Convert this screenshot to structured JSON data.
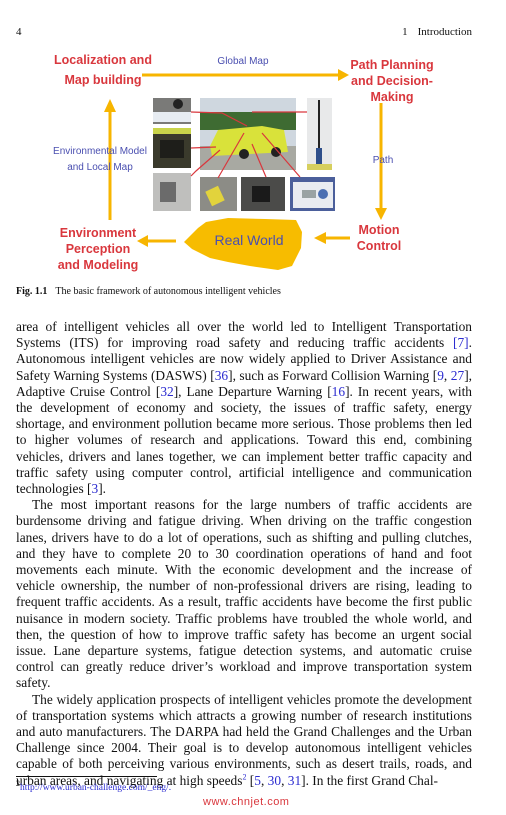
{
  "header": {
    "page_number": "4",
    "chapter_number": "1",
    "chapter_title": "Introduction"
  },
  "figure": {
    "nodes": {
      "localization_line1": "Localization and",
      "localization_line2": "Map building",
      "path_planning_line1": "Path Planning",
      "path_planning_line2": "and Decision-",
      "path_planning_line3": "Making",
      "environment_line1": "Environment",
      "environment_line2": "Perception",
      "environment_line3": "and Modeling",
      "motion_line1": "Motion",
      "motion_line2": "Control",
      "real_world": "Real World"
    },
    "edge_labels": {
      "global_map": "Global Map",
      "env_model_line1": "Environmental Model",
      "env_model_line2": "and Local Map",
      "path": "Path"
    },
    "colors": {
      "node_text": "#d9373d",
      "edge_text": "#4a4fb0",
      "arrow": "#f7b500",
      "real_world_fill": "#f7bc00",
      "pointer_lines": "#d9373d"
    },
    "caption_label": "Fig. 1.1",
    "caption_text": "The basic framework of autonomous intelligent vehicles"
  },
  "body": {
    "p1": [
      {
        "t": "area of intelligent vehicles all over the world led to Intelligent Transportation Systems (ITS) for improving road safety and reducing traffic accidents "
      },
      {
        "c": "[7]"
      },
      {
        "t": ". Autonomous intelligent vehicles are now widely applied to Driver Assistance and Safety Warning Systems (DASWS) ["
      },
      {
        "c": "36"
      },
      {
        "t": "], such as Forward Collision Warning ["
      },
      {
        "c": "9"
      },
      {
        "t": ", "
      },
      {
        "c": "27"
      },
      {
        "t": "], Adaptive Cruise Control ["
      },
      {
        "c": "32"
      },
      {
        "t": "], Lane Departure Warning ["
      },
      {
        "c": "16"
      },
      {
        "t": "]. In recent years, with the development of economy and society, the issues of traffic safety, energy shortage, and environment pollution became more serious. Those problems then led to higher volumes of research and applications. Toward this end, combining vehicles, drivers and lanes together, we can implement better traffic capacity and traffic safety using computer control, artificial intelligence and communication technologies ["
      },
      {
        "c": "3"
      },
      {
        "t": "]."
      }
    ],
    "p2": "The most important reasons for the large numbers of traffic accidents are burdensome driving and fatigue driving. When driving on the traffic congestion lanes, drivers have to do a lot of operations, such as shifting and pulling clutches, and they have to complete 20 to 30 coordination operations of hand and foot movements each minute. With the economic development and the increase of vehicle ownership, the number of non-professional drivers are rising, leading to frequent traffic accidents. As a result, traffic accidents have become the first public nuisance in modern society. Traffic problems have troubled the whole world, and then, the question of how to improve traffic safety has become an urgent social issue. Lane departure systems, fatigue detection systems, and automatic cruise control can greatly reduce driver’s workload and improve transportation system safety.",
    "p3": [
      {
        "t": "The widely application prospects of intelligent vehicles promote the development of transportation systems which attracts a growing number of research institutions and auto manufacturers. The DARPA had held the Grand Challenges and the Urban Challenge since 2004. Their goal is to develop autonomous intelligent vehicles capable of both perceiving various environments, such as desert trails, roads, and urban areas, and navigating at high speeds"
      },
      {
        "s": "2"
      },
      {
        "t": " ["
      },
      {
        "c": "5"
      },
      {
        "t": ", "
      },
      {
        "c": "30"
      },
      {
        "t": ", "
      },
      {
        "c": "31"
      },
      {
        "t": "]. In the first Grand Chal-"
      }
    ]
  },
  "footnote": {
    "mark": "2",
    "url": "http://www.urban-challenge.com/_eng/."
  },
  "watermark": "www.chnjet.com"
}
